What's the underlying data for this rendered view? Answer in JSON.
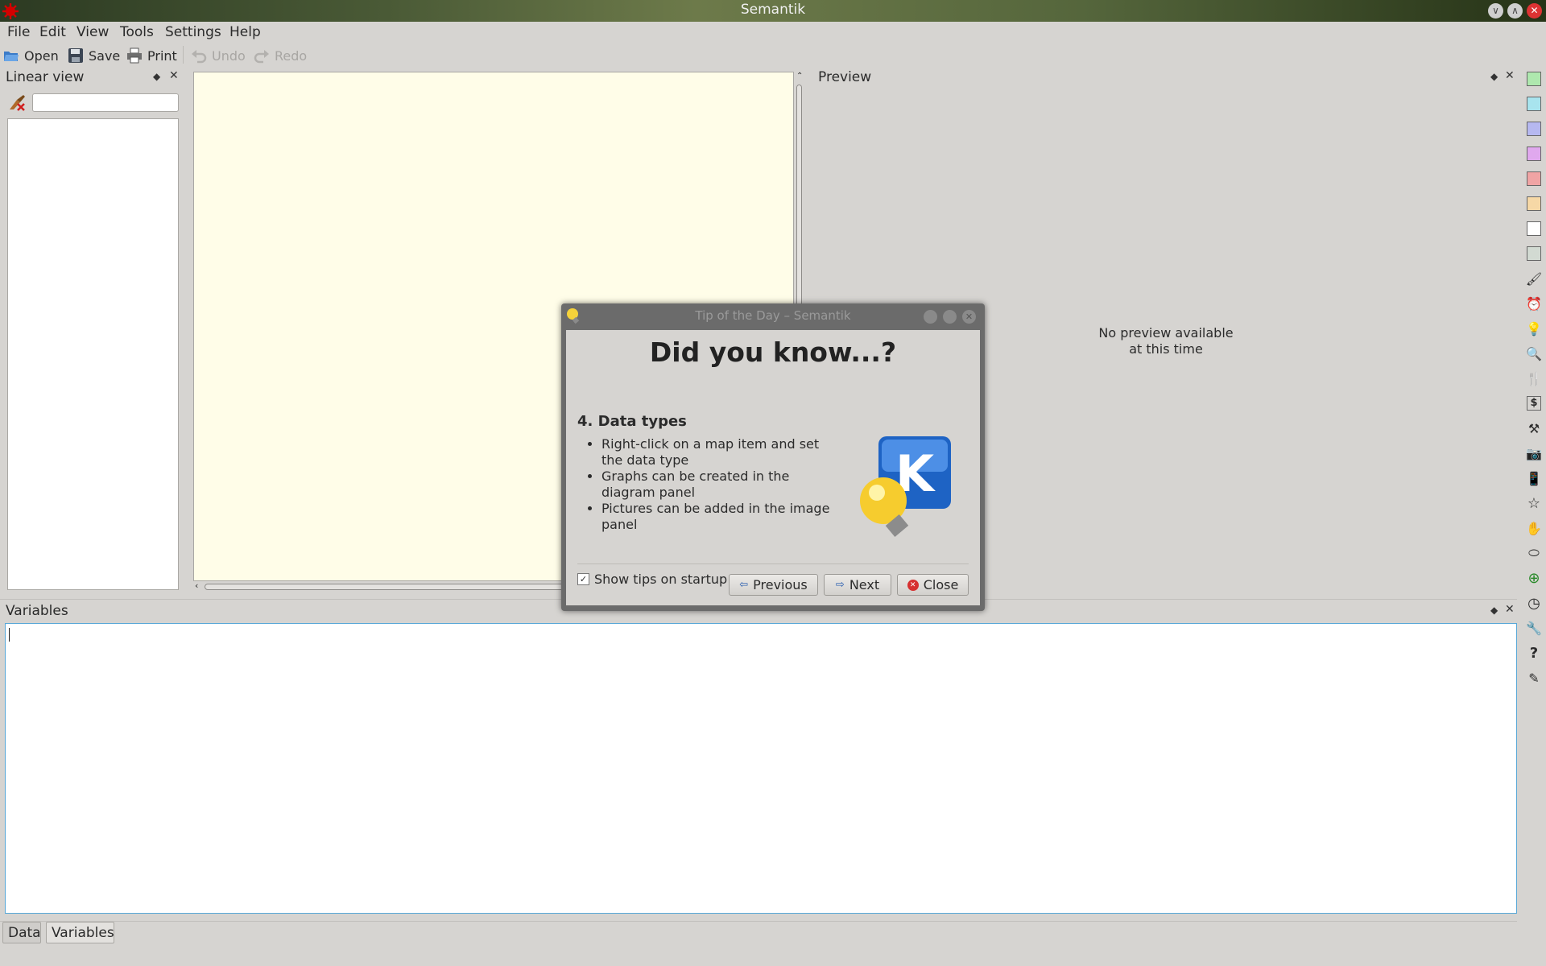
{
  "window": {
    "title": "Semantik"
  },
  "menu": [
    "File",
    "Edit",
    "View",
    "Tools",
    "Settings",
    "Help"
  ],
  "toolbar": {
    "open": "Open",
    "save": "Save",
    "print": "Print",
    "undo": "Undo",
    "redo": "Redo"
  },
  "linear_view": {
    "title": "Linear view",
    "filter_value": ""
  },
  "preview": {
    "title": "Preview",
    "message_line1": "No preview available",
    "message_line2": "at this time"
  },
  "variables": {
    "title": "Variables",
    "content": ""
  },
  "bottom_tabs": [
    "Data",
    "Variables"
  ],
  "dialog": {
    "title": "Tip of the Day – Semantik",
    "heading": "Did you know...?",
    "tip_title": "4. Data types",
    "tips": [
      "Right-click on a map item and set the data type",
      "Graphs can be created in the diagram panel",
      "Pictures can be added in the image panel"
    ],
    "checkbox_label": "Show tips on startup",
    "checkbox_checked": true,
    "previous": "Previous",
    "next": "Next",
    "close": "Close"
  },
  "colors": {
    "canvas": "#fffde8",
    "panel_bg": "#d6d4d1",
    "focus_border": "#58a8d8",
    "swatches": [
      "#aee8ae",
      "#a8e4ee",
      "#b6b8f0",
      "#e0a8ee",
      "#f0a4a4",
      "#f6d8a6",
      "#ffffff",
      "#d2dad2"
    ]
  },
  "side_icons": [
    "paint-brush-icon",
    "alarm-clock-icon",
    "light-bulb-icon",
    "magnifier-icon",
    "fork-knife-icon",
    "dollar-icon",
    "gavel-icon",
    "camera-icon",
    "phone-icon",
    "star-icon",
    "hand-icon",
    "lasso-icon",
    "target-icon",
    "clock-icon",
    "wrench-icon",
    "question-icon",
    "note-edit-icon"
  ]
}
